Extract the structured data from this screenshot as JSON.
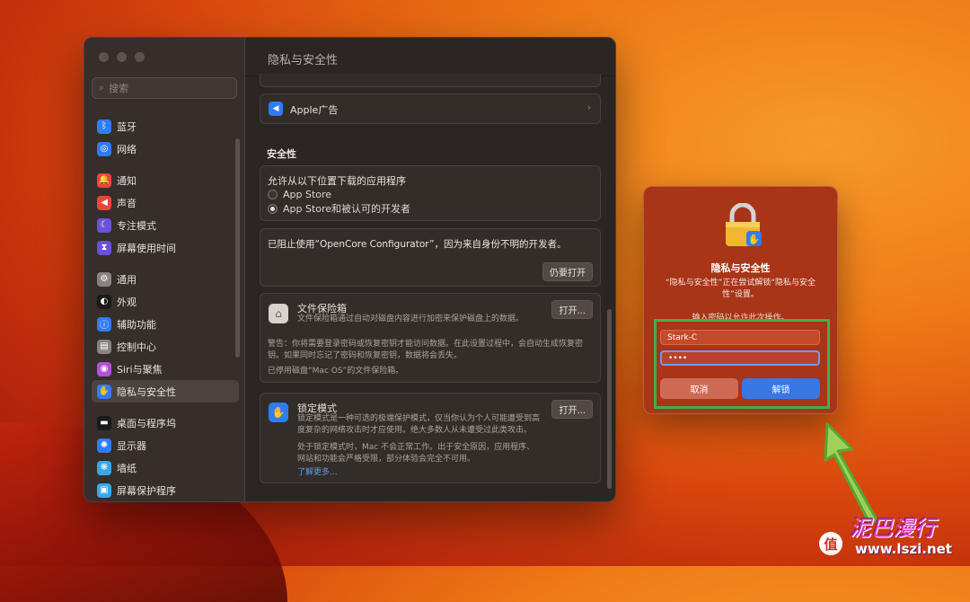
{
  "window": {
    "title": "隐私与安全性",
    "search_placeholder": "搜索"
  },
  "sidebar": {
    "items": [
      {
        "label": "蓝牙",
        "color": "#2f7cf6",
        "icon": "bluetooth-icon",
        "glyph": "ᛒ"
      },
      {
        "label": "网络",
        "color": "#2f7cf6",
        "icon": "globe-icon",
        "glyph": "◎"
      },
      {
        "label": "通知",
        "color": "#e8463d",
        "icon": "bell-icon",
        "glyph": "🔔"
      },
      {
        "label": "声音",
        "color": "#e8463d",
        "icon": "speaker-icon",
        "glyph": "◀"
      },
      {
        "label": "专注模式",
        "color": "#6a52d8",
        "icon": "moon-icon",
        "glyph": "☾"
      },
      {
        "label": "屏幕使用时间",
        "color": "#6a52d8",
        "icon": "hourglass-icon",
        "glyph": "⧗"
      },
      {
        "label": "通用",
        "color": "#8a8480",
        "icon": "gear-icon",
        "glyph": "⚙"
      },
      {
        "label": "外观",
        "color": "#1a1a1a",
        "icon": "appearance-icon",
        "glyph": "◐"
      },
      {
        "label": "辅助功能",
        "color": "#2f7cf6",
        "icon": "accessibility-icon",
        "glyph": "ⓘ"
      },
      {
        "label": "控制中心",
        "color": "#8a8480",
        "icon": "control-center-icon",
        "glyph": "▤"
      },
      {
        "label": "Siri与聚焦",
        "color": "#b450d8",
        "icon": "siri-icon",
        "glyph": "◉"
      },
      {
        "label": "隐私与安全性",
        "color": "#2f7cf6",
        "icon": "hand-icon",
        "glyph": "✋"
      },
      {
        "label": "桌面与程序坞",
        "color": "#1a1a1a",
        "icon": "dock-icon",
        "glyph": "▬"
      },
      {
        "label": "显示器",
        "color": "#2f7cf6",
        "icon": "display-icon",
        "glyph": "✺"
      },
      {
        "label": "墙纸",
        "color": "#3aa8e8",
        "icon": "wallpaper-icon",
        "glyph": "❋"
      },
      {
        "label": "屏幕保护程序",
        "color": "#3aa8e8",
        "icon": "screensaver-icon",
        "glyph": "▣"
      }
    ]
  },
  "main": {
    "apple_ads_label": "Apple广告",
    "security_heading": "安全性",
    "allow_apps_label": "允许从以下位置下载的应用程序",
    "radio_app_store": "App Store",
    "radio_app_store_dev": "App Store和被认可的开发者",
    "blocked_text": "已阻止使用“OpenCore Configurator”，因为来自身份不明的开发者。",
    "open_anyway": "仍要打开",
    "filevault_title": "文件保险箱",
    "filevault_desc": "文件保险箱通过自动对磁盘内容进行加密来保护磁盘上的数据。",
    "filevault_btn": "打开...",
    "filevault_warning": "警告：你将需要登录密码或恢复密钥才能访问数据。在此设置过程中，会自动生成恢复密钥。如果同时忘记了密码和恢复密钥，数据将会丢失。",
    "filevault_disabled": "已停用磁盘“Mac OS”的文件保险箱。",
    "lockdown_title": "锁定模式",
    "lockdown_btn": "打开...",
    "lockdown_desc": "锁定模式是一种可选的极端保护模式，仅当你认为个人可能遭受到高度复杂的网络攻击时才应使用。绝大多数人从未遭受过此类攻击。",
    "lockdown_desc2": "处于锁定模式时，Mac 不会正常工作。出于安全原因，应用程序、网站和功能会严格受限，部分体验会完全不可用。",
    "learn_more": "了解更多..."
  },
  "dialog": {
    "title": "隐私与安全性",
    "description": "“隐私与安全性”正在尝试解锁“隐私与安全性”设置。",
    "prompt": "输入密码以允许此次操作。",
    "username": "Stark-C",
    "password_mask": "••••",
    "cancel": "取消",
    "unlock": "解锁"
  },
  "watermark": {
    "brand": "值",
    "script_text": "泥巴漫行",
    "url": "www.lszi.net"
  },
  "colors": {
    "accent_blue": "#3678e6",
    "highlight_green": "#3fb04a",
    "dialog_red": "#a83518"
  }
}
